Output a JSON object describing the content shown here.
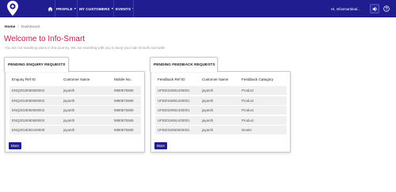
{
  "nav": {
    "items": [
      {
        "label": "PROFILE"
      },
      {
        "label": "MY CUSTOMERS"
      },
      {
        "label": "EVENTS"
      }
    ],
    "greeting": "Hi, Infosmartdeal...",
    "colors": {
      "navbar": "#1f1d8f",
      "accent": "#b8204a"
    }
  },
  "breadcrumb": {
    "home": "Home",
    "separator": "/",
    "current": "Dashboard"
  },
  "welcome": {
    "title": "Welcome to Info-Smart",
    "subtitle": "You are not travelling alone in this journey. We are travelling with you to keep your ride smooth and safe!"
  },
  "enquiry": {
    "tab_label": "PENDING ENQUIRY REQUESTS",
    "columns": [
      "Enquiry Ref ID",
      "Customer Name",
      "Mobile No."
    ],
    "rows": [
      [
        "ENQ2019060600002",
        "jayanth",
        "9880875589"
      ],
      [
        "ENQ2019060600002",
        "jayanth",
        "9880875589"
      ],
      [
        "ENQ2019060600002",
        "jayanth",
        "9880875589"
      ],
      [
        "ENQ2019060600002",
        "jayanth",
        "9880875589"
      ],
      [
        "ENQ2019052100009",
        "jayanth",
        "9880875589"
      ]
    ],
    "more_label": "More"
  },
  "feedback": {
    "tab_label": "PENDING FEEDBACK REQUESTS",
    "columns": [
      "Feedback Ref ID",
      "Customer Name",
      "Feedback Category"
    ],
    "rows": [
      [
        "UFB2019061400001",
        "jayanth",
        "Product"
      ],
      [
        "UFB2019061400001",
        "jayanth",
        "Product"
      ],
      [
        "UFB2019061400001",
        "jayanth",
        "Product"
      ],
      [
        "UFB2019061400001",
        "jayanth",
        "Product"
      ],
      [
        "UFB2019060500001",
        "jayanth",
        "Dealer"
      ]
    ],
    "more_label": "More"
  }
}
